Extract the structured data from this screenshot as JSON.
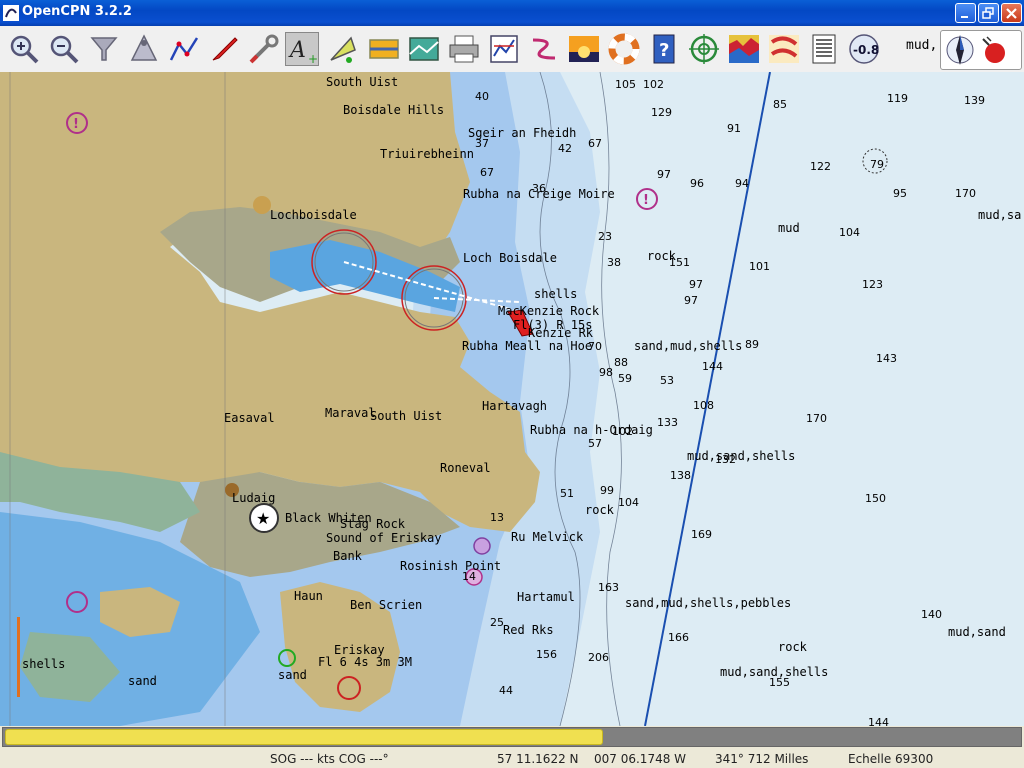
{
  "window": {
    "title": "OpenCPN 3.2.2"
  },
  "toolbar": {
    "buttons": [
      "zoom-in",
      "zoom-out",
      "scale-in",
      "scale-out",
      "route",
      "ais",
      "tools",
      "text",
      "track",
      "quilt",
      "settings",
      "print",
      "charts",
      "layout",
      "sunset",
      "lifebuoy",
      "help",
      "target",
      "tides",
      "current",
      "list",
      "sea-level"
    ],
    "value_label": "-0.8",
    "overflow_label": "mud,"
  },
  "progress": {
    "fraction": 0.59
  },
  "status": {
    "sog_cog": "SOG --- kts  COG ---°",
    "lat": "57 11.1622 N",
    "lon": "007 06.1748 W",
    "bearing": "341°  712 Milles",
    "scale": "Echelle 69300"
  },
  "chart": {
    "place_names": [
      {
        "t": "South Uist"
      },
      {
        "t": "Boisdale Hills"
      },
      {
        "t": "Sgeir an Fheidh"
      },
      {
        "t": "Triuirebheinn"
      },
      {
        "t": "Rubha na Creige Moire"
      },
      {
        "t": "Lochboisdale"
      },
      {
        "t": "Loch Boisdale"
      },
      {
        "t": "MacKenzie Rock"
      },
      {
        "t": "Fl(3) R 15s"
      },
      {
        "t": "Kenzie Rk"
      },
      {
        "t": "Rubha Meall na Hoe"
      },
      {
        "t": "sand,mud,shells"
      },
      {
        "t": "Hartavagh"
      },
      {
        "t": "Rubha na h-Ordaig"
      },
      {
        "t": "Easaval"
      },
      {
        "t": "Maraval"
      },
      {
        "t": "South Uist"
      },
      {
        "t": "Roneval"
      },
      {
        "t": "mud,sand,shells"
      },
      {
        "t": "Ludaig"
      },
      {
        "t": "Black Whiten"
      },
      {
        "t": "Stag Rock"
      },
      {
        "t": "Sound of Eriskay"
      },
      {
        "t": "Bank"
      },
      {
        "t": "Rosinish Point"
      },
      {
        "t": "Hartamul"
      },
      {
        "t": "Ben Scrien"
      },
      {
        "t": "Haun"
      },
      {
        "t": "Eriskay"
      },
      {
        "t": "Red Rks"
      },
      {
        "t": "sand,mud,shells,pebbles"
      },
      {
        "t": "rock"
      },
      {
        "t": "rock"
      },
      {
        "t": "rock"
      },
      {
        "t": "mud,sand,shells"
      },
      {
        "t": "mud,sand"
      },
      {
        "t": "sand"
      },
      {
        "t": "shells"
      },
      {
        "t": "mud,sa"
      },
      {
        "t": "mud"
      },
      {
        "t": "Ru Melvick"
      },
      {
        "t": "shells"
      },
      {
        "t": "Fl 6 4s 3m 3M"
      },
      {
        "t": "sand"
      }
    ],
    "soundings": [
      "105",
      "102",
      "85",
      "119",
      "139",
      "129",
      "91",
      "122",
      "79",
      "95",
      "170",
      "97",
      "96",
      "94",
      "104",
      "151",
      "101",
      "123",
      "89",
      "97",
      "143",
      "144",
      "170",
      "108",
      "132",
      "138",
      "169",
      "150",
      "163",
      "166",
      "140",
      "156",
      "206",
      "155",
      "144",
      "40",
      "37",
      "42",
      "67",
      "67",
      "36",
      "23",
      "38",
      "70",
      "88",
      "53",
      "99",
      "102",
      "98",
      "133",
      "104",
      "57",
      "59",
      "51",
      "13",
      "14",
      "25",
      "97",
      "44"
    ]
  },
  "colors": {
    "land": "#c9b67e",
    "drying": "#a8a78a",
    "shallow": "#5aa5e0",
    "medium": "#a4c8ee",
    "deep": "#dcecf5",
    "route": "#1a4fb0"
  }
}
